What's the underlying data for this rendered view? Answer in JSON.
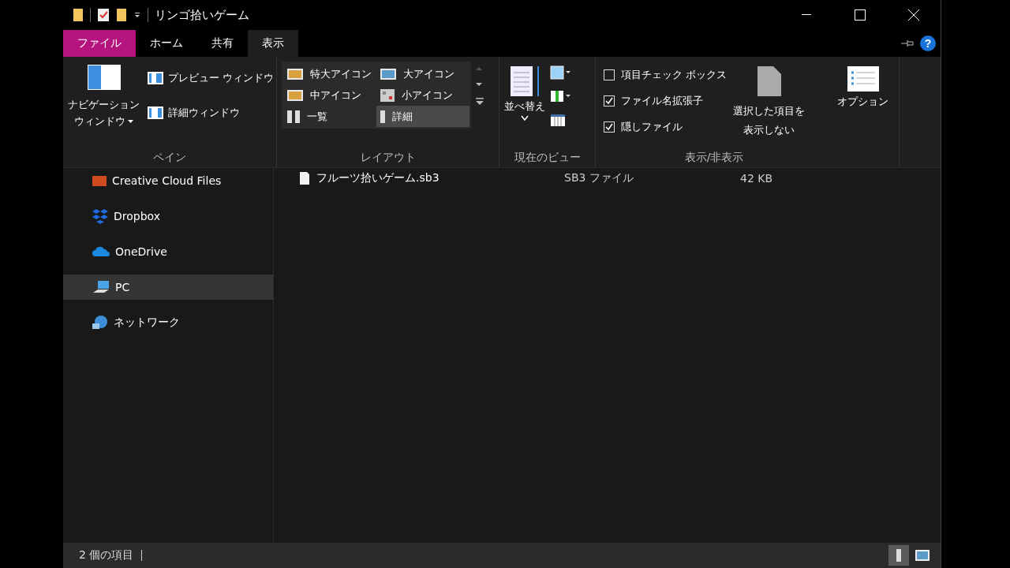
{
  "window": {
    "title": "リンゴ拾いゲーム"
  },
  "tabs": [
    {
      "label": "ファイル",
      "kind": "file",
      "selected": false
    },
    {
      "label": "ホーム",
      "kind": "tab",
      "selected": false
    },
    {
      "label": "共有",
      "kind": "tab",
      "selected": false
    },
    {
      "label": "表示",
      "kind": "tab",
      "selected": true
    }
  ],
  "help": "?",
  "ribbon": {
    "pane": {
      "label": "ペイン",
      "navigation": [
        "ナビゲーション",
        "ウィンドウ"
      ],
      "items": [
        {
          "label": "プレビュー ウィンドウ",
          "kind": "preview"
        },
        {
          "label": "詳細ウィンドウ",
          "kind": "details"
        }
      ]
    },
    "layout": {
      "label": "レイアウト",
      "options": [
        {
          "label": "特大アイコン",
          "kind": "xl",
          "selected": false
        },
        {
          "label": "大アイコン",
          "kind": "large",
          "selected": false
        },
        {
          "label": "中アイコン",
          "kind": "medium",
          "selected": false
        },
        {
          "label": "小アイコン",
          "kind": "small",
          "selected": false
        },
        {
          "label": "一覧",
          "kind": "list",
          "selected": false
        },
        {
          "label": "詳細",
          "kind": "details",
          "selected": true
        }
      ]
    },
    "current_view": {
      "label": "現在のビュー",
      "sort": "並べ替え"
    },
    "show_hide": {
      "label": "表示/非表示",
      "checkboxes": [
        {
          "label": "項目チェック ボックス",
          "checked": false
        },
        {
          "label": "ファイル名拡張子",
          "checked": true
        },
        {
          "label": "隠しファイル",
          "checked": true
        }
      ],
      "hide_selected": [
        "選択した項目を",
        "表示しない"
      ]
    },
    "options": {
      "label": "オプション"
    }
  },
  "sidebar": {
    "items": [
      {
        "label": "Creative Cloud Files",
        "kind": "creative",
        "selected": false
      },
      {
        "label": "Dropbox",
        "kind": "dropbox",
        "selected": false
      },
      {
        "label": "OneDrive",
        "kind": "onedrive",
        "selected": false
      },
      {
        "label": "PC",
        "kind": "pc",
        "selected": true
      },
      {
        "label": "ネットワーク",
        "kind": "network",
        "selected": false
      }
    ]
  },
  "files": [
    {
      "name": "フルーツ拾いゲーム.sb3",
      "type": "SB3 ファイル",
      "size": "42 KB"
    }
  ],
  "status_bar": {
    "count": "2 個の項目",
    "views": [
      {
        "kind": "details",
        "selected": true
      },
      {
        "kind": "tiles",
        "selected": false
      }
    ]
  }
}
